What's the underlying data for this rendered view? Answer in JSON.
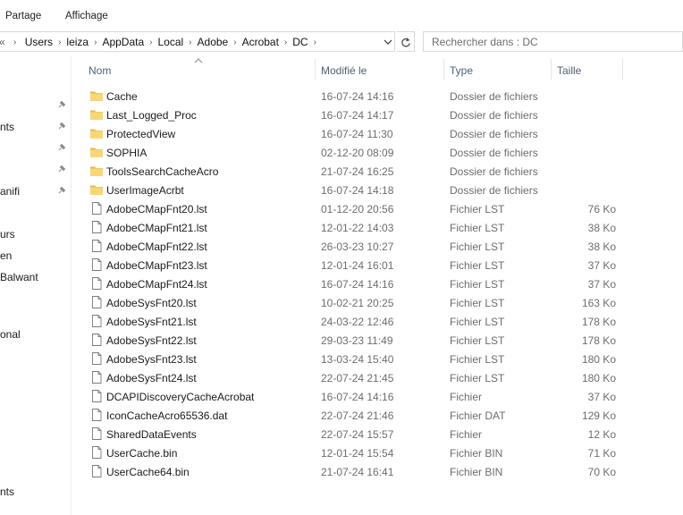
{
  "ribbon": {
    "tabs": [
      "Partage",
      "Affichage"
    ]
  },
  "address": {
    "back_glyph": "«",
    "crumbs": [
      "Users",
      "leiza",
      "AppData",
      "Local",
      "Adobe",
      "Acrobat",
      "DC"
    ],
    "separator": "›"
  },
  "search": {
    "placeholder": "Rechercher dans : DC"
  },
  "nav": {
    "items": [
      "nts",
      "anifi",
      "urs",
      "en",
      "Balwant",
      "onal",
      "nts"
    ]
  },
  "columns": {
    "name": "Nom",
    "modified": "Modifié le",
    "type": "Type",
    "size": "Taille"
  },
  "files": [
    {
      "name": "Cache",
      "modified": "16-07-24 14:16",
      "type": "Dossier de fichiers",
      "size": "",
      "icon": "folder-icon"
    },
    {
      "name": "Last_Logged_Proc",
      "modified": "16-07-24 14:17",
      "type": "Dossier de fichiers",
      "size": "",
      "icon": "folder-icon"
    },
    {
      "name": "ProtectedView",
      "modified": "16-07-24 11:30",
      "type": "Dossier de fichiers",
      "size": "",
      "icon": "folder-icon"
    },
    {
      "name": "SOPHIA",
      "modified": "02-12-20 08:09",
      "type": "Dossier de fichiers",
      "size": "",
      "icon": "folder-icon"
    },
    {
      "name": "ToolsSearchCacheAcro",
      "modified": "21-07-24 16:25",
      "type": "Dossier de fichiers",
      "size": "",
      "icon": "folder-icon"
    },
    {
      "name": "UserImageAcrbt",
      "modified": "16-07-24 14:18",
      "type": "Dossier de fichiers",
      "size": "",
      "icon": "folder-icon"
    },
    {
      "name": "AdobeCMapFnt20.lst",
      "modified": "01-12-20 20:56",
      "type": "Fichier LST",
      "size": "76 Ko",
      "icon": "file-icon"
    },
    {
      "name": "AdobeCMapFnt21.lst",
      "modified": "12-01-22 14:03",
      "type": "Fichier LST",
      "size": "38 Ko",
      "icon": "file-icon"
    },
    {
      "name": "AdobeCMapFnt22.lst",
      "modified": "26-03-23 10:27",
      "type": "Fichier LST",
      "size": "38 Ko",
      "icon": "file-icon"
    },
    {
      "name": "AdobeCMapFnt23.lst",
      "modified": "12-01-24 16:01",
      "type": "Fichier LST",
      "size": "37 Ko",
      "icon": "file-icon"
    },
    {
      "name": "AdobeCMapFnt24.lst",
      "modified": "16-07-24 14:16",
      "type": "Fichier LST",
      "size": "37 Ko",
      "icon": "file-icon"
    },
    {
      "name": "AdobeSysFnt20.lst",
      "modified": "10-02-21 20:25",
      "type": "Fichier LST",
      "size": "163 Ko",
      "icon": "file-icon"
    },
    {
      "name": "AdobeSysFnt21.lst",
      "modified": "24-03-22 12:46",
      "type": "Fichier LST",
      "size": "178 Ko",
      "icon": "file-icon"
    },
    {
      "name": "AdobeSysFnt22.lst",
      "modified": "29-03-23 11:49",
      "type": "Fichier LST",
      "size": "178 Ko",
      "icon": "file-icon"
    },
    {
      "name": "AdobeSysFnt23.lst",
      "modified": "13-03-24 15:40",
      "type": "Fichier LST",
      "size": "180 Ko",
      "icon": "file-icon"
    },
    {
      "name": "AdobeSysFnt24.lst",
      "modified": "22-07-24 21:45",
      "type": "Fichier LST",
      "size": "180 Ko",
      "icon": "file-icon"
    },
    {
      "name": "DCAPIDiscoveryCacheAcrobat",
      "modified": "16-07-24 14:16",
      "type": "Fichier",
      "size": "37 Ko",
      "icon": "file-icon"
    },
    {
      "name": "IconCacheAcro65536.dat",
      "modified": "22-07-24 21:46",
      "type": "Fichier DAT",
      "size": "129 Ko",
      "icon": "file-icon"
    },
    {
      "name": "SharedDataEvents",
      "modified": "22-07-24 15:57",
      "type": "Fichier",
      "size": "12 Ko",
      "icon": "file-icon"
    },
    {
      "name": "UserCache.bin",
      "modified": "12-01-24 15:54",
      "type": "Fichier BIN",
      "size": "71 Ko",
      "icon": "file-icon"
    },
    {
      "name": "UserCache64.bin",
      "modified": "21-07-24 16:41",
      "type": "Fichier BIN",
      "size": "70 Ko",
      "icon": "file-icon"
    }
  ],
  "colors": {
    "folder": "#f8d775",
    "folder_dark": "#e8b84a",
    "header_text": "#4c607a",
    "muted_text": "#6d6d6d"
  }
}
